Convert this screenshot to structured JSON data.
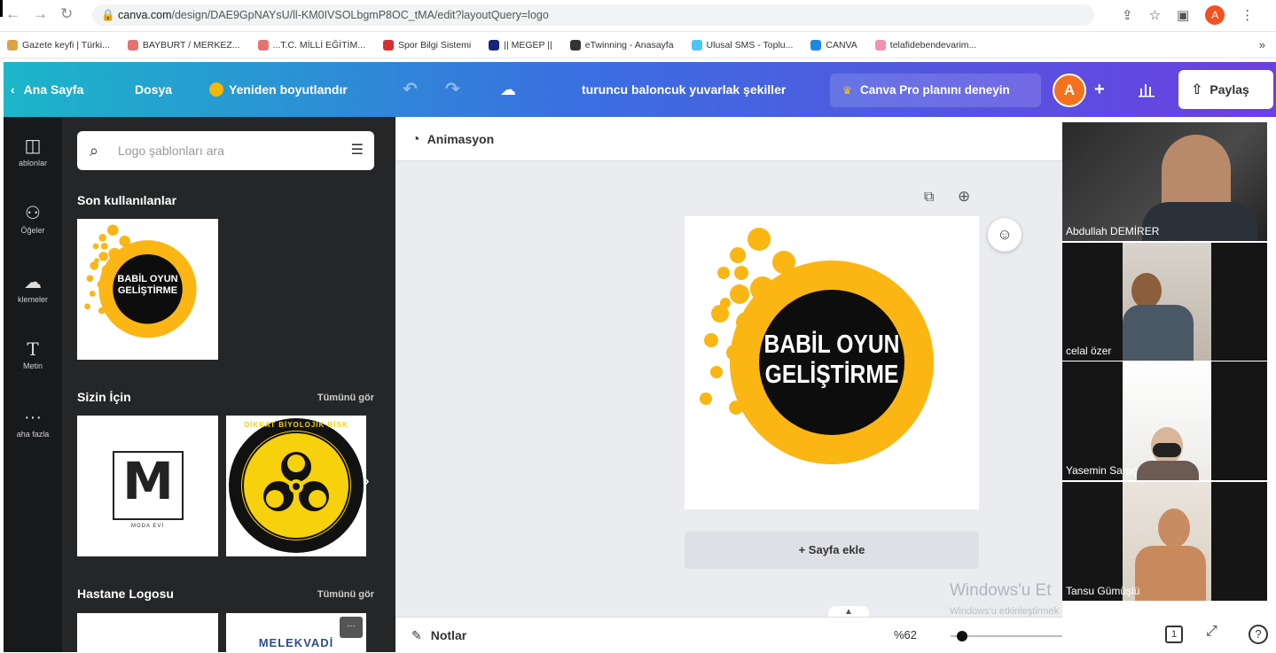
{
  "browser": {
    "url_host": "canva.com",
    "url_path": "/design/DAE9GpNAYsU/ll-KM0IVSOLbgmP8OC_tMA/edit?layoutQuery=logo",
    "profile_initial": "A",
    "bookmarks": [
      {
        "label": "Gazete keyfi | Türki...",
        "color": "#d9a441"
      },
      {
        "label": "BAYBURT / MERKEZ...",
        "color": "#e57373"
      },
      {
        "label": "...T.C. MİLLİ EĞİTİM...",
        "color": "#e57373"
      },
      {
        "label": "Spor Bilgi Sistemi",
        "color": "#d32f2f"
      },
      {
        "label": "|| MEGEP ||",
        "color": "#1a237e"
      },
      {
        "label": "eTwinning - Anasayfa",
        "color": "#333333"
      },
      {
        "label": "Ulusal SMS - Toplu...",
        "color": "#4fc3f7"
      },
      {
        "label": "CANVA",
        "color": "#1e88e5"
      },
      {
        "label": "telafidebendevarim...",
        "color": "#f48fb1"
      }
    ],
    "bookmarks_more": "»"
  },
  "topbar": {
    "home": "Ana Sayfa",
    "file": "Dosya",
    "resize": "Yeniden boyutlandır",
    "doc_title": "turuncu baloncuk yuvarlak şekiller",
    "pro": "Canva Pro planını deneyin",
    "avatar_initial": "A",
    "share": "Paylaş"
  },
  "rail": {
    "items": [
      {
        "label": "ablonlar",
        "icon": "template-icon"
      },
      {
        "label": "Öğeler",
        "icon": "elements-icon"
      },
      {
        "label": "klemeler",
        "icon": "upload-icon"
      },
      {
        "label": "Metin",
        "icon": "text-icon"
      },
      {
        "label": "aha fazla",
        "icon": "more-icon"
      }
    ]
  },
  "panel": {
    "search_placeholder": "Logo şablonları ara",
    "recent_title": "Son kullanılanlar",
    "for_you_title": "Sizin İçin",
    "see_all": "Tümünü gör",
    "hospital_title": "Hastane Logosu",
    "see_all_2": "Tümünü gör",
    "thumb_logo_line1": "BABİL OYUN",
    "thumb_logo_line2": "GELİŞTİRME",
    "moda_letter": "M",
    "moda_caption": "MODA EVİ",
    "bio_text": "DİKKAT BİYOLOJİK RİSK",
    "melek_text": "MELEKVADİ"
  },
  "editor": {
    "animation": "Animasyon",
    "logo_line1": "BABİL OYUN",
    "logo_line2": "GELİŞTİRME",
    "add_page": "+ Sayfa ekle",
    "notes": "Notlar",
    "zoom": "%62",
    "zoom_fraction": 0.1,
    "page_count": "1",
    "watermark_title": "Windows'u Et",
    "watermark_sub": "Windows'u etkinleştirmek için Ayarlar'a gidin."
  },
  "participants": [
    {
      "name": "Abdullah DEMİRER"
    },
    {
      "name": "celal özer"
    },
    {
      "name": "Yasemin Saraç"
    },
    {
      "name": "Tansu Gümüşlü"
    }
  ],
  "colors": {
    "logo_yellow": "#fbb614",
    "logo_black": "#0d0d0d"
  }
}
